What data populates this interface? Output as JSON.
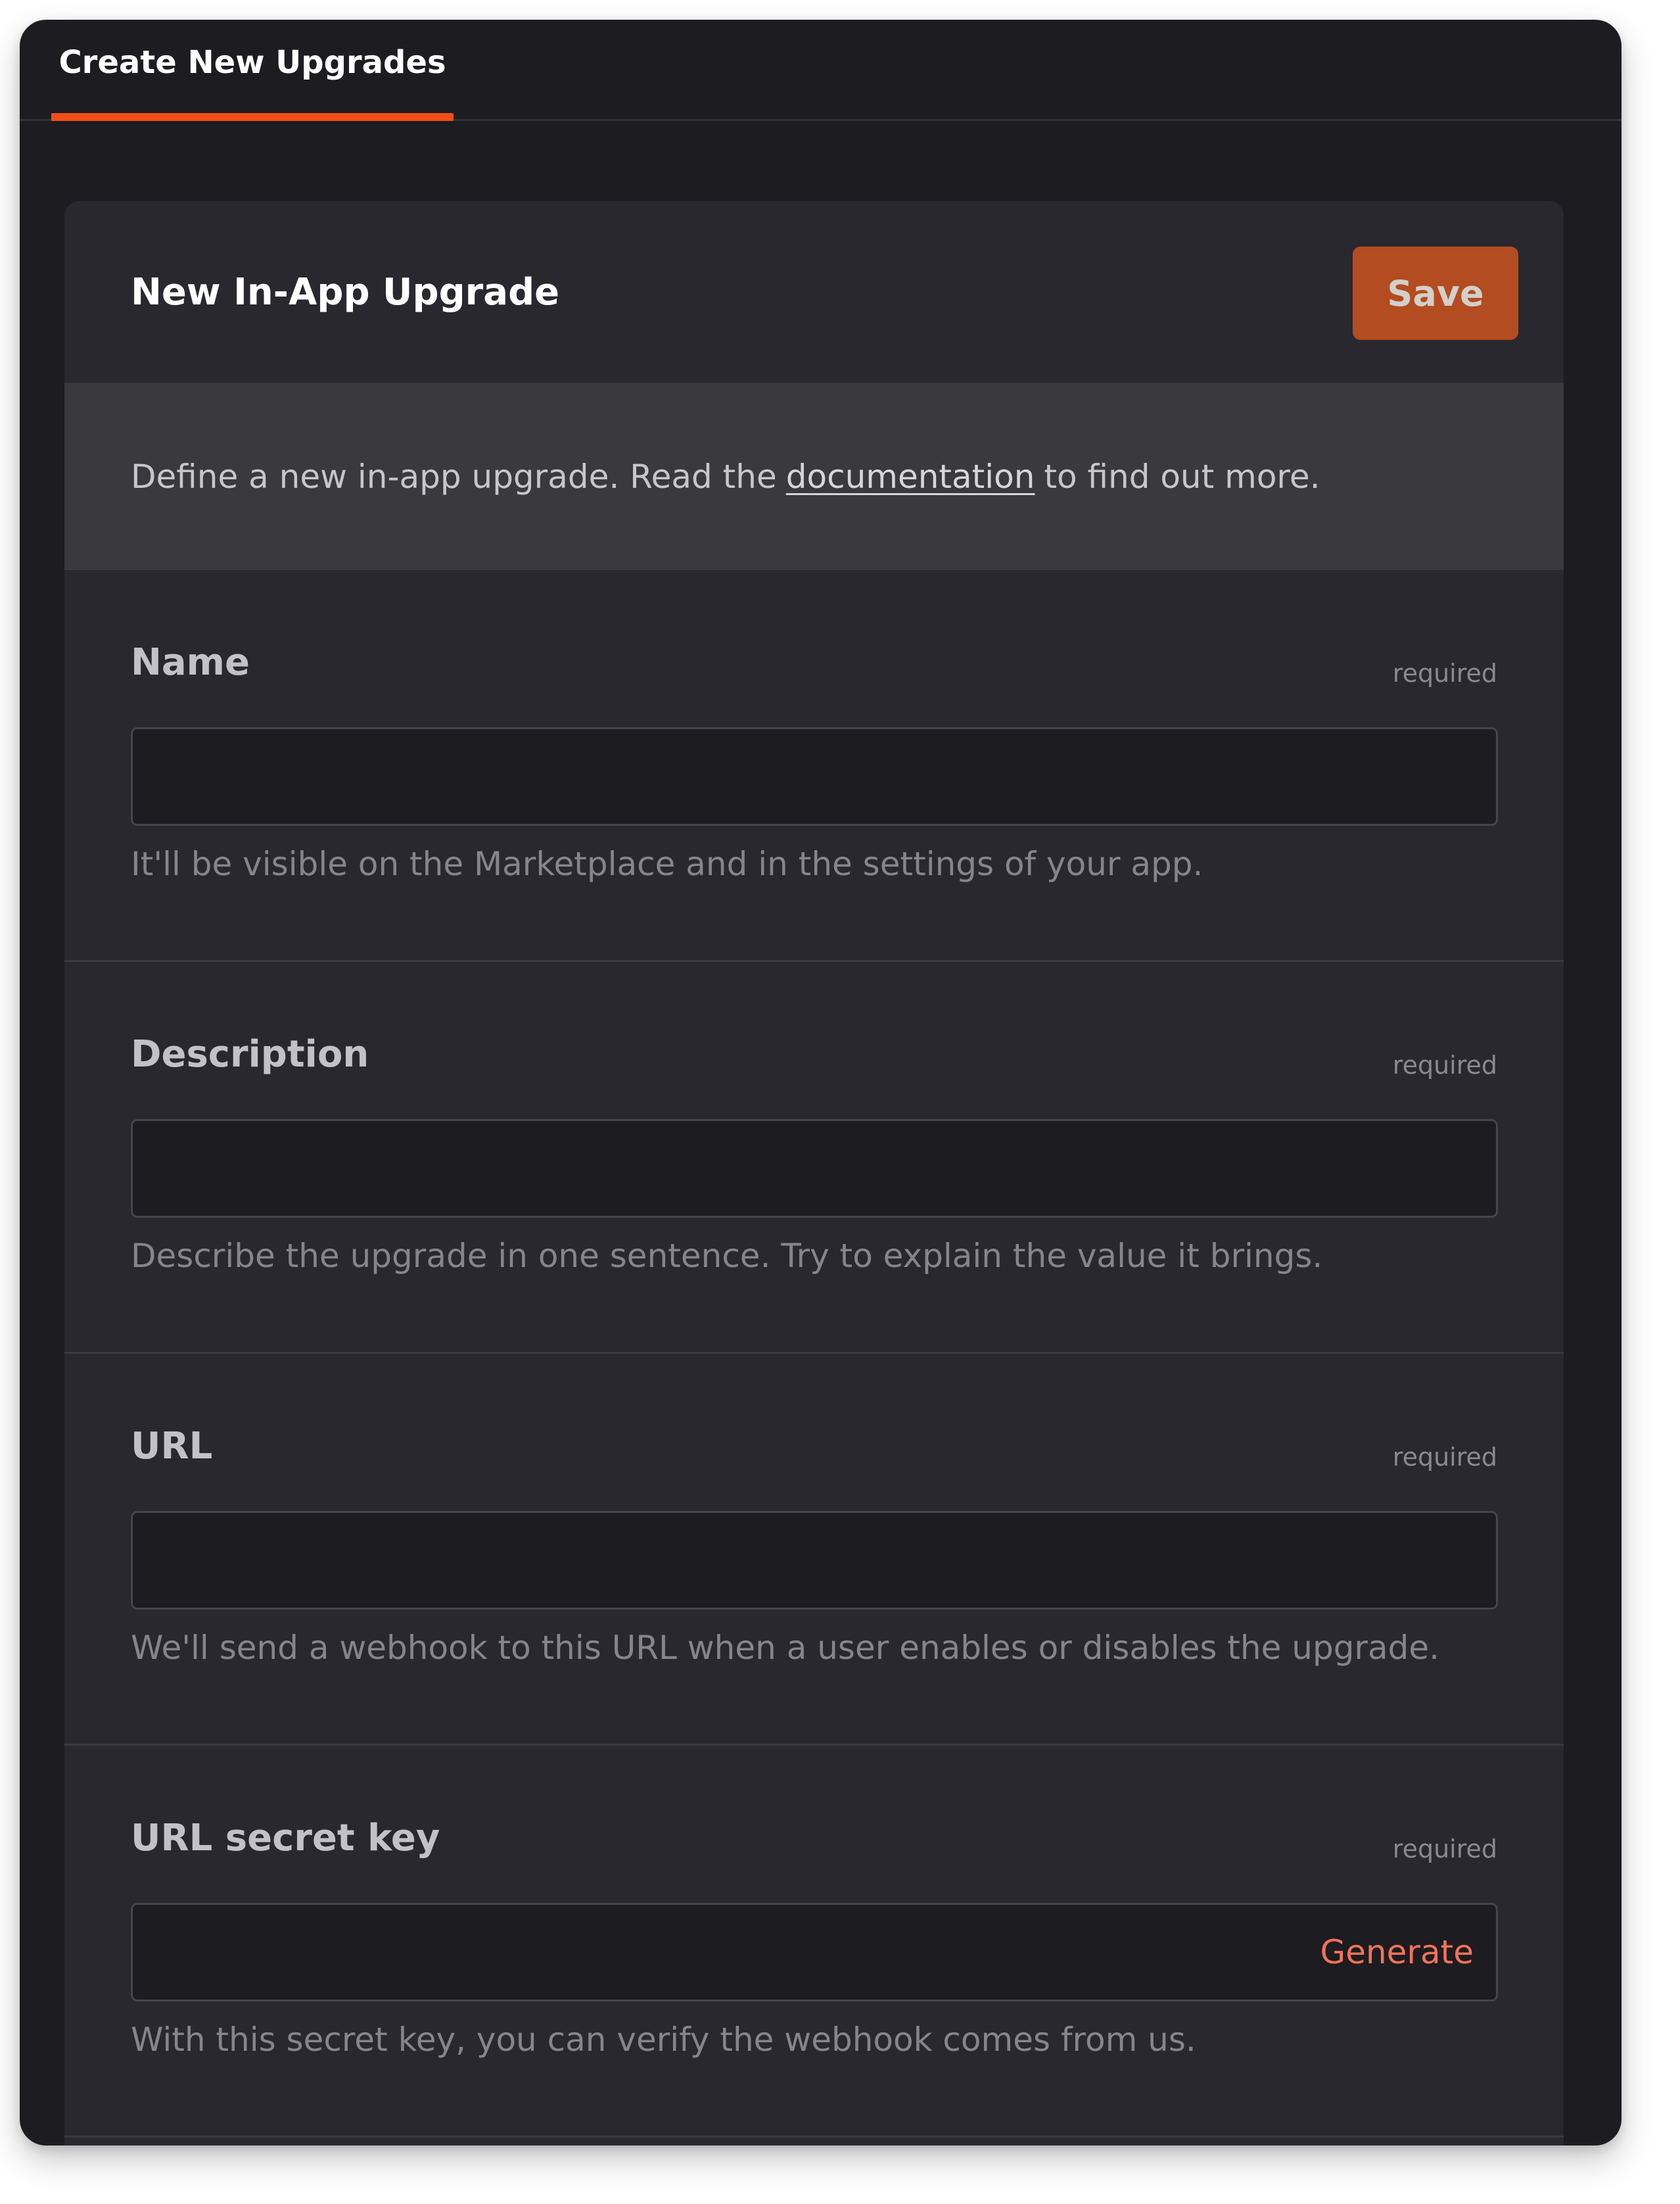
{
  "tabs": [
    {
      "label": "Create New Upgrades",
      "active": true
    }
  ],
  "accent_color": "#f24d18",
  "card": {
    "title": "New In-App Upgrade",
    "save_label": "Save",
    "intro": {
      "before": "Define a new in-app upgrade. Read the",
      "link": "documentation",
      "after": "to find out more."
    }
  },
  "fields": [
    {
      "label": "Name",
      "required": "required",
      "value": "",
      "help": "It'll be visible on the Marketplace and in the settings of your app."
    },
    {
      "label": "Description",
      "required": "required",
      "value": "",
      "help": "Describe the upgrade in one sentence. Try to explain the value it brings."
    },
    {
      "label": "URL",
      "required": "required",
      "value": "",
      "help": "We'll send a webhook to this URL when a user enables or disables the upgrade."
    },
    {
      "label": "URL secret key",
      "required": "required",
      "value": "",
      "action": "Generate",
      "help": "With this secret key, you can verify the webhook comes from us."
    }
  ]
}
